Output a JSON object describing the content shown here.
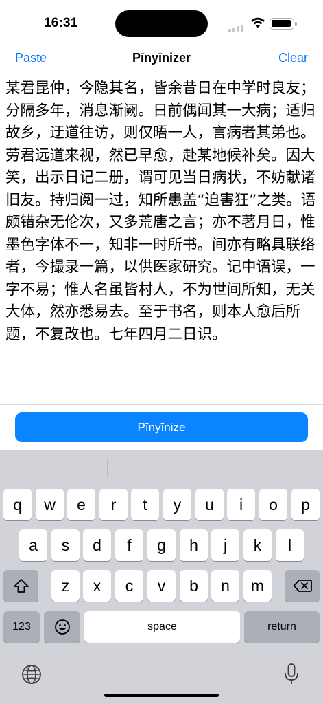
{
  "status": {
    "time": "16:31"
  },
  "nav": {
    "left_label": "Paste",
    "title": "Pīnyīnizer",
    "right_label": "Clear"
  },
  "editor": {
    "text": "某君昆仲，今隐其名，皆余昔日在中学时良友；分隔多年，消息渐阙。日前偶闻其一大病；适归故乡，迂道往访，则仅晤一人，言病者其弟也。劳君远道来视，然已早愈，赴某地候补矣。因大笑，出示日记二册，谓可见当日病状，不妨献诸旧友。持归阅一过，知所患盖“迫害狂”之类。语颇错杂无伦次，又多荒唐之言；亦不著月日，惟墨色字体不一，知非一时所书。间亦有略具联络者，今撮录一篇，以供医家研究。记中语误，一字不易；惟人名虽皆村人，不为世间所知，无关大体，然亦悉易去。至于书名，则本人愈后所题，不复改也。七年四月二日识。"
  },
  "action_button": {
    "label": "Pīnyīnize"
  },
  "keyboard": {
    "row1": [
      "q",
      "w",
      "e",
      "r",
      "t",
      "y",
      "u",
      "i",
      "o",
      "p"
    ],
    "row2": [
      "a",
      "s",
      "d",
      "f",
      "g",
      "h",
      "j",
      "k",
      "l"
    ],
    "row3": [
      "z",
      "x",
      "c",
      "v",
      "b",
      "n",
      "m"
    ],
    "numbers_label": "123",
    "space_label": "space",
    "return_label": "return",
    "icons": {
      "shift": "shift-icon",
      "delete": "backspace-icon",
      "emoji": "emoji-icon",
      "globe": "globe-icon",
      "mic": "microphone-icon"
    }
  },
  "colors": {
    "accent": "#0a84ff",
    "keyboard_bg": "#d1d3d9",
    "key_bg": "#ffffff",
    "key_dark_bg": "#abafb8"
  }
}
